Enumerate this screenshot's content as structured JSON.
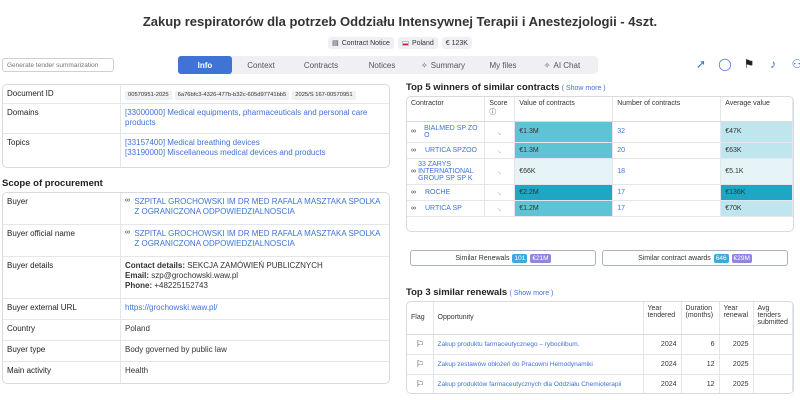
{
  "title": "Zakup respiratorów dla potrzeb Oddziału Intensywnej Terapii i Anestezjologii - 4szt.",
  "meta": {
    "type": "Contract Notice",
    "country": "Poland",
    "value": "€ 123K"
  },
  "generate_placeholder": "Generate tender summarization",
  "tabs": [
    "Info",
    "Context",
    "Contracts",
    "Notices",
    "Summary",
    "My files",
    "AI Chat"
  ],
  "info": {
    "document_id_label": "Document ID",
    "document_ids": [
      "00570951-2025",
      "6a76bfc3-4326-477b-b32c-605d97741bb5",
      "2025/S 167-00570951"
    ],
    "domains_label": "Domains",
    "domains": [
      "[33000000] Medical equipments, pharmaceuticals and personal care products"
    ],
    "topics_label": "Topics",
    "topics": [
      "[33157400] Medical breathing devices",
      "[33190000] Miscellaneous medical devices and products"
    ]
  },
  "scope": {
    "heading": "Scope of procurement",
    "buyer_label": "Buyer",
    "buyer": "SZPITAL GROCHOWSKI IM DR MED RAFALA MASZTAKA SPOLKA Z OGRANICZONA ODPOWIEDZIALNOSCIA",
    "buyer_official_label": "Buyer official name",
    "buyer_official": "SZPITAL GROCHOWSKI IM DR MED RAFALA MASZTAKA SPOLKA Z OGRANICZONA ODPOWIEDZIALNOSCIA",
    "details_label": "Buyer details",
    "contact_key": "Contact details:",
    "contact_val": "SEKCJA ZAMÓWIEŃ PUBLICZNYCH",
    "email_key": "Email:",
    "email_val": "szp@grochowski.waw.pl",
    "phone_key": "Phone:",
    "phone_val": "+48225152743",
    "external_label": "Buyer external URL",
    "external_url": "https://grochowski.waw.pl/",
    "country_label": "Country",
    "country": "Poland",
    "type_label": "Buyer type",
    "type": "Body governed by public law",
    "activity_label": "Main activity",
    "activity": "Health"
  },
  "winners": {
    "heading": "Top 5 winners of similar contracts",
    "show_more": "( Show more )",
    "headers": [
      "Contractor",
      "Score",
      "Value of contracts",
      "Number of contracts",
      "Average value"
    ],
    "rows": [
      {
        "name": "BIALMED SP ZO O",
        "value": "€1.3M",
        "count": "32",
        "avg": "€47K"
      },
      {
        "name": "URTICA SPZOO",
        "value": "€1.3M",
        "count": "20",
        "avg": "€63K"
      },
      {
        "name": "33 ZARYS INTERNATIONAL GROUP SP SP K",
        "value": "€66K",
        "count": "18",
        "avg": "€5.1K"
      },
      {
        "name": "ROCHE",
        "value": "€2.2M",
        "count": "17",
        "avg": "€136K"
      },
      {
        "name": "URTICA SP",
        "value": "€1.2M",
        "count": "17",
        "avg": "€70K"
      }
    ]
  },
  "similar": {
    "renewals_label": "Similar Renewals",
    "renewals_count": "101",
    "renewals_value": "€21M",
    "awards_label": "Similar contract awards",
    "awards_count": "646",
    "awards_value": "€29M"
  },
  "renewals": {
    "heading": "Top 3 similar renewals",
    "show_more": "( Show more )",
    "headers": [
      "Flag",
      "Opportunity",
      "Year tendered",
      "Duration (months)",
      "Year renewal",
      "Avg tenders submitted"
    ],
    "rows": [
      {
        "name": "Zakup produktu farmaceutycznego – rybocilibum.",
        "year": "2024",
        "duration": "6",
        "renewal": "2025"
      },
      {
        "name": "Zakup zestawów obłożeń do Pracowni Hemodynamiki",
        "year": "2024",
        "duration": "12",
        "renewal": "2025"
      },
      {
        "name": "Zakup produktów farmaceutycznych dla Oddziału Chemioterapii",
        "year": "2024",
        "duration": "12",
        "renewal": "2025"
      }
    ]
  },
  "colors": {
    "accent": "#3f73d6",
    "teal_light": "#bfe6ef",
    "teal_mid": "#5fc3d6",
    "teal_dark": "#1fa6c4",
    "badge_blue": "#3fa9d9",
    "badge_purple": "#8f86e0"
  }
}
